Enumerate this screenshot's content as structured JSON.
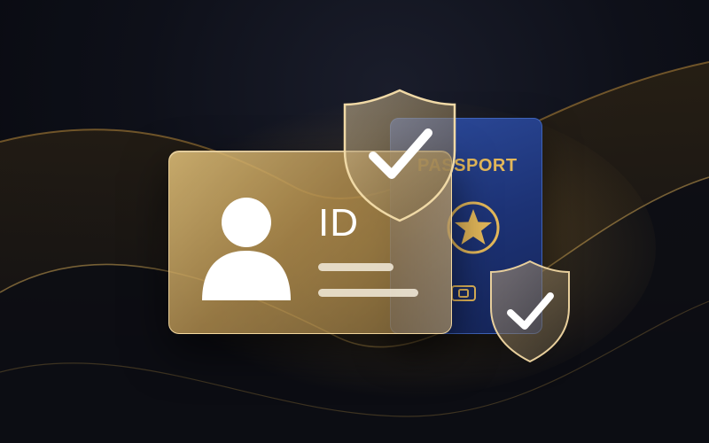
{
  "scene": {
    "description_colors": {
      "background": "#0d0f17",
      "gold_accent": "#e4b85a",
      "passport_blue": "#1d3376",
      "card_gold": "#c9a564"
    }
  },
  "id_card": {
    "label": "ID",
    "avatar_icon": "user-silhouette-icon",
    "text_lines": 2
  },
  "passport": {
    "title": "PASSPORT",
    "emblem_icon": "star-emblem-icon",
    "chip_icon": "chip-icon"
  },
  "badges": [
    {
      "icon": "shield-check-icon"
    },
    {
      "icon": "shield-check-icon"
    }
  ]
}
